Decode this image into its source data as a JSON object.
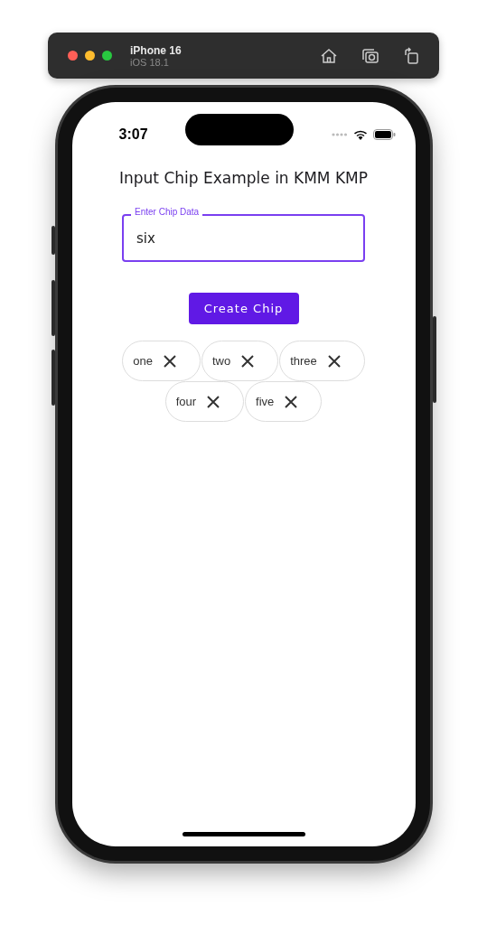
{
  "simulator": {
    "device": "iPhone 16",
    "os": "iOS 18.1"
  },
  "status_bar": {
    "time": "3:07"
  },
  "title": "Input Chip Example in KMM KMP",
  "field": {
    "label": "Enter Chip Data",
    "value": "six",
    "focused": true
  },
  "button": "Create Chip",
  "chips": [
    {
      "label": "one"
    },
    {
      "label": "two"
    },
    {
      "label": "three"
    },
    {
      "label": "four"
    },
    {
      "label": "five"
    }
  ]
}
